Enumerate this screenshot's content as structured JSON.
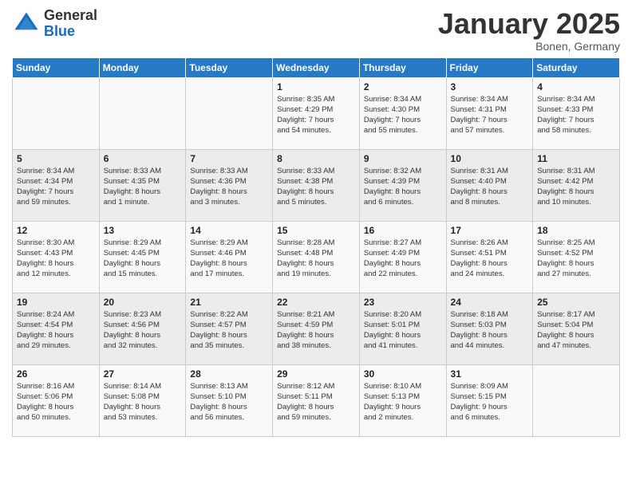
{
  "logo": {
    "general": "General",
    "blue": "Blue"
  },
  "title": "January 2025",
  "location": "Bonen, Germany",
  "days_of_week": [
    "Sunday",
    "Monday",
    "Tuesday",
    "Wednesday",
    "Thursday",
    "Friday",
    "Saturday"
  ],
  "weeks": [
    [
      {
        "day": "",
        "info": ""
      },
      {
        "day": "",
        "info": ""
      },
      {
        "day": "",
        "info": ""
      },
      {
        "day": "1",
        "info": "Sunrise: 8:35 AM\nSunset: 4:29 PM\nDaylight: 7 hours\nand 54 minutes."
      },
      {
        "day": "2",
        "info": "Sunrise: 8:34 AM\nSunset: 4:30 PM\nDaylight: 7 hours\nand 55 minutes."
      },
      {
        "day": "3",
        "info": "Sunrise: 8:34 AM\nSunset: 4:31 PM\nDaylight: 7 hours\nand 57 minutes."
      },
      {
        "day": "4",
        "info": "Sunrise: 8:34 AM\nSunset: 4:33 PM\nDaylight: 7 hours\nand 58 minutes."
      }
    ],
    [
      {
        "day": "5",
        "info": "Sunrise: 8:34 AM\nSunset: 4:34 PM\nDaylight: 7 hours\nand 59 minutes."
      },
      {
        "day": "6",
        "info": "Sunrise: 8:33 AM\nSunset: 4:35 PM\nDaylight: 8 hours\nand 1 minute."
      },
      {
        "day": "7",
        "info": "Sunrise: 8:33 AM\nSunset: 4:36 PM\nDaylight: 8 hours\nand 3 minutes."
      },
      {
        "day": "8",
        "info": "Sunrise: 8:33 AM\nSunset: 4:38 PM\nDaylight: 8 hours\nand 5 minutes."
      },
      {
        "day": "9",
        "info": "Sunrise: 8:32 AM\nSunset: 4:39 PM\nDaylight: 8 hours\nand 6 minutes."
      },
      {
        "day": "10",
        "info": "Sunrise: 8:31 AM\nSunset: 4:40 PM\nDaylight: 8 hours\nand 8 minutes."
      },
      {
        "day": "11",
        "info": "Sunrise: 8:31 AM\nSunset: 4:42 PM\nDaylight: 8 hours\nand 10 minutes."
      }
    ],
    [
      {
        "day": "12",
        "info": "Sunrise: 8:30 AM\nSunset: 4:43 PM\nDaylight: 8 hours\nand 12 minutes."
      },
      {
        "day": "13",
        "info": "Sunrise: 8:29 AM\nSunset: 4:45 PM\nDaylight: 8 hours\nand 15 minutes."
      },
      {
        "day": "14",
        "info": "Sunrise: 8:29 AM\nSunset: 4:46 PM\nDaylight: 8 hours\nand 17 minutes."
      },
      {
        "day": "15",
        "info": "Sunrise: 8:28 AM\nSunset: 4:48 PM\nDaylight: 8 hours\nand 19 minutes."
      },
      {
        "day": "16",
        "info": "Sunrise: 8:27 AM\nSunset: 4:49 PM\nDaylight: 8 hours\nand 22 minutes."
      },
      {
        "day": "17",
        "info": "Sunrise: 8:26 AM\nSunset: 4:51 PM\nDaylight: 8 hours\nand 24 minutes."
      },
      {
        "day": "18",
        "info": "Sunrise: 8:25 AM\nSunset: 4:52 PM\nDaylight: 8 hours\nand 27 minutes."
      }
    ],
    [
      {
        "day": "19",
        "info": "Sunrise: 8:24 AM\nSunset: 4:54 PM\nDaylight: 8 hours\nand 29 minutes."
      },
      {
        "day": "20",
        "info": "Sunrise: 8:23 AM\nSunset: 4:56 PM\nDaylight: 8 hours\nand 32 minutes."
      },
      {
        "day": "21",
        "info": "Sunrise: 8:22 AM\nSunset: 4:57 PM\nDaylight: 8 hours\nand 35 minutes."
      },
      {
        "day": "22",
        "info": "Sunrise: 8:21 AM\nSunset: 4:59 PM\nDaylight: 8 hours\nand 38 minutes."
      },
      {
        "day": "23",
        "info": "Sunrise: 8:20 AM\nSunset: 5:01 PM\nDaylight: 8 hours\nand 41 minutes."
      },
      {
        "day": "24",
        "info": "Sunrise: 8:18 AM\nSunset: 5:03 PM\nDaylight: 8 hours\nand 44 minutes."
      },
      {
        "day": "25",
        "info": "Sunrise: 8:17 AM\nSunset: 5:04 PM\nDaylight: 8 hours\nand 47 minutes."
      }
    ],
    [
      {
        "day": "26",
        "info": "Sunrise: 8:16 AM\nSunset: 5:06 PM\nDaylight: 8 hours\nand 50 minutes."
      },
      {
        "day": "27",
        "info": "Sunrise: 8:14 AM\nSunset: 5:08 PM\nDaylight: 8 hours\nand 53 minutes."
      },
      {
        "day": "28",
        "info": "Sunrise: 8:13 AM\nSunset: 5:10 PM\nDaylight: 8 hours\nand 56 minutes."
      },
      {
        "day": "29",
        "info": "Sunrise: 8:12 AM\nSunset: 5:11 PM\nDaylight: 8 hours\nand 59 minutes."
      },
      {
        "day": "30",
        "info": "Sunrise: 8:10 AM\nSunset: 5:13 PM\nDaylight: 9 hours\nand 2 minutes."
      },
      {
        "day": "31",
        "info": "Sunrise: 8:09 AM\nSunset: 5:15 PM\nDaylight: 9 hours\nand 6 minutes."
      },
      {
        "day": "",
        "info": ""
      }
    ]
  ]
}
